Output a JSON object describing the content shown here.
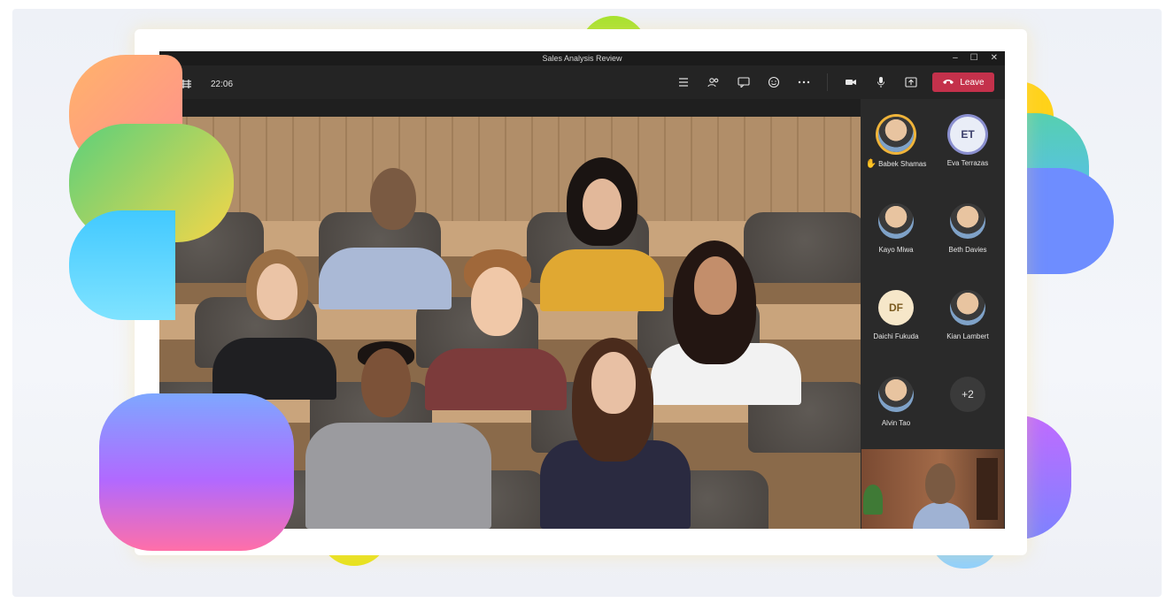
{
  "window": {
    "title": "Sales Analysis Review",
    "controls": [
      "–",
      "☐",
      "✕"
    ]
  },
  "toolbar": {
    "grid_icon": "grid-icon",
    "time": "22:06",
    "icons": [
      "list-icon",
      "people-icon",
      "chat-icon",
      "reactions-icon",
      "more-icon",
      "camera-icon",
      "mic-icon",
      "share-icon"
    ],
    "leave_label": "Leave"
  },
  "participants": [
    {
      "name": "Babek Shamas",
      "type": "photo",
      "raised_hand": true
    },
    {
      "name": "Eva Terrazas",
      "type": "initials",
      "initials": "ET"
    },
    {
      "name": "Kayo Miwa",
      "type": "photo"
    },
    {
      "name": "Beth Davies",
      "type": "photo"
    },
    {
      "name": "Daichi Fukuda",
      "type": "initials",
      "initials": "DF"
    },
    {
      "name": "Kian Lambert",
      "type": "photo"
    },
    {
      "name": "Alvin Tao",
      "type": "photo"
    }
  ],
  "more_count": "+2",
  "colors": {
    "leave": "#c4314b",
    "raised_hand_ring": "#f0b43a",
    "app_bg": "#1f1f1f"
  }
}
